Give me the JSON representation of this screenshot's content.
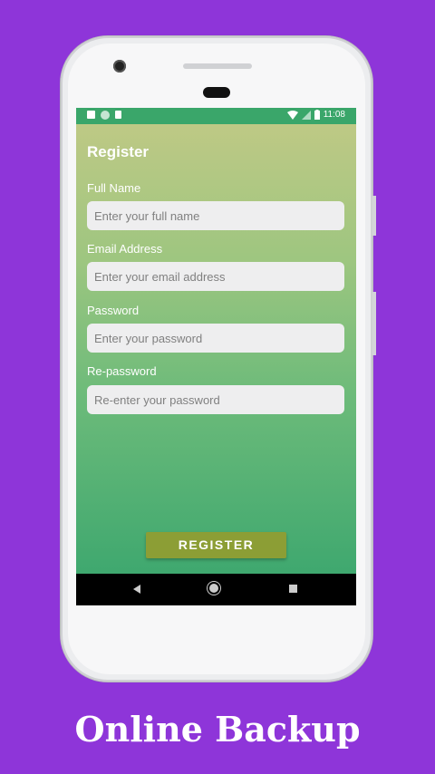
{
  "status_bar": {
    "time": "11:08"
  },
  "form": {
    "title": "Register",
    "fields": [
      {
        "label": "Full Name",
        "placeholder": "Enter your full name"
      },
      {
        "label": "Email Address",
        "placeholder": "Enter your email address"
      },
      {
        "label": "Password",
        "placeholder": "Enter your password"
      },
      {
        "label": "Re-password",
        "placeholder": "Re-enter your password"
      }
    ],
    "submit_label": "REGISTER"
  },
  "icons": {
    "status_left": [
      "notification-icon",
      "sync-icon",
      "sd-card-icon"
    ],
    "status_right": [
      "wifi-icon",
      "signal-icon",
      "battery-icon"
    ],
    "nav": [
      "back-icon",
      "home-icon",
      "recents-icon"
    ]
  },
  "colors": {
    "background": "#8e35d9",
    "status_bar": "#3aa66a",
    "button": "#8c9e35",
    "gradient_top": "#bec985",
    "gradient_bottom": "#3fa86f"
  },
  "caption": "Online Backup"
}
